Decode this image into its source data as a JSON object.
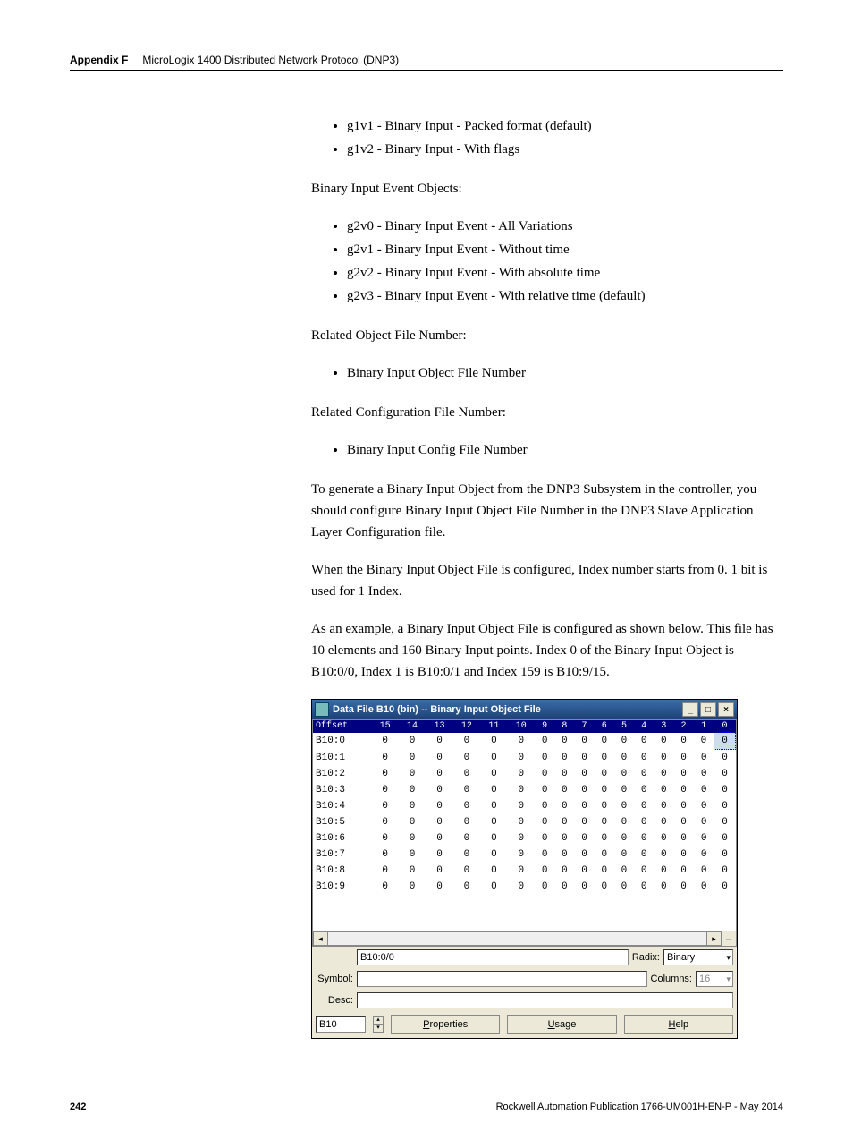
{
  "header": {
    "appendix": "Appendix F",
    "title": "MicroLogix 1400 Distributed Network Protocol (DNP3)"
  },
  "body": {
    "list1": [
      "g1v1 - Binary Input - Packed format (default)",
      "g1v2 - Binary Input - With flags"
    ],
    "h1": "Binary Input Event Objects:",
    "list2": [
      "g2v0 - Binary Input Event - All Variations",
      "g2v1 - Binary Input Event - Without time",
      "g2v2 - Binary Input Event - With absolute time",
      "g2v3 - Binary Input Event - With relative time (default)"
    ],
    "h2": "Related Object File Number:",
    "list3": [
      "Binary Input Object File Number"
    ],
    "h3": "Related Configuration File Number:",
    "list4": [
      "Binary Input Config File Number"
    ],
    "p1": "To generate a Binary Input Object from the DNP3 Subsystem in the controller, you should configure Binary Input Object File Number in the DNP3 Slave Application Layer Configuration file.",
    "p2": "When the Binary Input Object File is configured, Index number starts from 0. 1 bit is used for 1 Index.",
    "p3": "As an example, a Binary Input Object File is configured as shown below. This file has 10 elements and 160 Binary Input points. Index 0 of the Binary Input Object is B10:0/0, Index 1 is B10:0/1 and Index 159 is B10:9/15."
  },
  "win": {
    "title": "Data File B10 (bin)  --  Binary Input Object File",
    "cols": [
      "Offset",
      "15",
      "14",
      "13",
      "12",
      "11",
      "10",
      "9",
      "8",
      "7",
      "6",
      "5",
      "4",
      "3",
      "2",
      "1",
      "0"
    ],
    "rows": [
      {
        "off": "B10:0",
        "v": [
          "0",
          "0",
          "0",
          "0",
          "0",
          "0",
          "0",
          "0",
          "0",
          "0",
          "0",
          "0",
          "0",
          "0",
          "0",
          "0"
        ]
      },
      {
        "off": "B10:1",
        "v": [
          "0",
          "0",
          "0",
          "0",
          "0",
          "0",
          "0",
          "0",
          "0",
          "0",
          "0",
          "0",
          "0",
          "0",
          "0",
          "0"
        ]
      },
      {
        "off": "B10:2",
        "v": [
          "0",
          "0",
          "0",
          "0",
          "0",
          "0",
          "0",
          "0",
          "0",
          "0",
          "0",
          "0",
          "0",
          "0",
          "0",
          "0"
        ]
      },
      {
        "off": "B10:3",
        "v": [
          "0",
          "0",
          "0",
          "0",
          "0",
          "0",
          "0",
          "0",
          "0",
          "0",
          "0",
          "0",
          "0",
          "0",
          "0",
          "0"
        ]
      },
      {
        "off": "B10:4",
        "v": [
          "0",
          "0",
          "0",
          "0",
          "0",
          "0",
          "0",
          "0",
          "0",
          "0",
          "0",
          "0",
          "0",
          "0",
          "0",
          "0"
        ]
      },
      {
        "off": "B10:5",
        "v": [
          "0",
          "0",
          "0",
          "0",
          "0",
          "0",
          "0",
          "0",
          "0",
          "0",
          "0",
          "0",
          "0",
          "0",
          "0",
          "0"
        ]
      },
      {
        "off": "B10:6",
        "v": [
          "0",
          "0",
          "0",
          "0",
          "0",
          "0",
          "0",
          "0",
          "0",
          "0",
          "0",
          "0",
          "0",
          "0",
          "0",
          "0"
        ]
      },
      {
        "off": "B10:7",
        "v": [
          "0",
          "0",
          "0",
          "0",
          "0",
          "0",
          "0",
          "0",
          "0",
          "0",
          "0",
          "0",
          "0",
          "0",
          "0",
          "0"
        ]
      },
      {
        "off": "B10:8",
        "v": [
          "0",
          "0",
          "0",
          "0",
          "0",
          "0",
          "0",
          "0",
          "0",
          "0",
          "0",
          "0",
          "0",
          "0",
          "0",
          "0"
        ]
      },
      {
        "off": "B10:9",
        "v": [
          "0",
          "0",
          "0",
          "0",
          "0",
          "0",
          "0",
          "0",
          "0",
          "0",
          "0",
          "0",
          "0",
          "0",
          "0",
          "0"
        ]
      }
    ],
    "addr": "B10:0/0",
    "radix_label": "Radix:",
    "radix_value": "Binary",
    "symbol_label": "Symbol:",
    "columns_label": "Columns:",
    "columns_value": "16",
    "desc_label": "Desc:",
    "file_field": "B10",
    "btn_properties": "Properties",
    "btn_usage": "Usage",
    "btn_help": "Help"
  },
  "footer": {
    "page": "242",
    "pub": "Rockwell Automation Publication 1766-UM001H-EN-P - May 2014"
  }
}
